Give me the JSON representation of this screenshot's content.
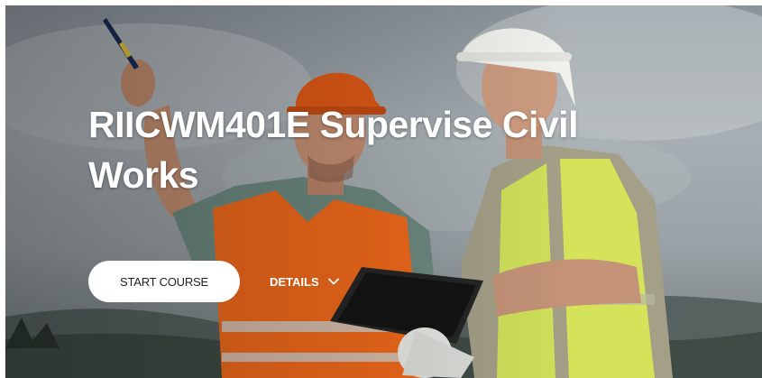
{
  "hero": {
    "title": "RIICWM401E Supervise Civil Works",
    "start_button_label": "START COURSE",
    "details_label": "DETAILS",
    "details_icon": "chevron-down-icon",
    "background_image": "two-construction-workers-with-hard-hats"
  },
  "colors": {
    "title_text": "#ffffff",
    "button_bg": "#ffffff",
    "button_text": "#222222",
    "orange_vest": "#f26a1b",
    "yellow_vest": "#d5e35a"
  }
}
